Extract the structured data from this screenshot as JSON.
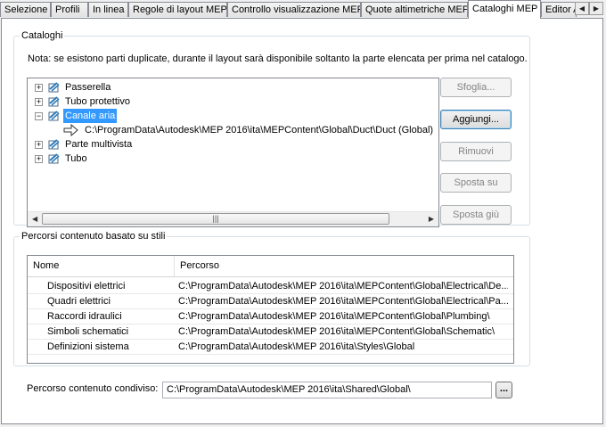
{
  "tabs": [
    {
      "label": "Selezione"
    },
    {
      "label": "Profili"
    },
    {
      "label": "In linea"
    },
    {
      "label": "Regole di layout MEP"
    },
    {
      "label": "Controllo visualizzazione MEP"
    },
    {
      "label": "Quote altimetriche MEP"
    },
    {
      "label": "Cataloghi MEP",
      "active": true
    },
    {
      "label": "Editor AEC"
    }
  ],
  "catalogs": {
    "group_title": "Cataloghi",
    "note": "Nota: se esistono parti duplicate, durante il layout sarà disponibile soltanto la parte elencata per prima nel catalogo.",
    "tree": [
      {
        "label": "Passerella",
        "expanded": false
      },
      {
        "label": "Tubo protettivo",
        "expanded": false
      },
      {
        "label": "Canale aria",
        "expanded": true,
        "selected": true,
        "children": [
          {
            "label": "C:\\ProgramData\\Autodesk\\MEP 2016\\ita\\MEPContent\\Global\\Duct\\Duct (Global)"
          }
        ]
      },
      {
        "label": "Parte multivista",
        "expanded": false
      },
      {
        "label": "Tubo",
        "expanded": false
      }
    ],
    "buttons": {
      "browse": "Sfoglia...",
      "add": "Aggiungi...",
      "remove": "Rimuovi",
      "move_up": "Sposta su",
      "move_down": "Sposta giù"
    }
  },
  "style_paths": {
    "group_title": "Percorsi contenuto basato su stili",
    "columns": [
      "Nome",
      "Percorso"
    ],
    "rows": [
      {
        "name": "Dispositivi elettrici",
        "path": "C:\\ProgramData\\Autodesk\\MEP 2016\\ita\\MEPContent\\Global\\Electrical\\De..."
      },
      {
        "name": "Quadri elettrici",
        "path": "C:\\ProgramData\\Autodesk\\MEP 2016\\ita\\MEPContent\\Global\\Electrical\\Pa..."
      },
      {
        "name": "Raccordi idraulici",
        "path": "C:\\ProgramData\\Autodesk\\MEP 2016\\ita\\MEPContent\\Global\\Plumbing\\"
      },
      {
        "name": "Simboli schematici",
        "path": "C:\\ProgramData\\Autodesk\\MEP 2016\\ita\\MEPContent\\Global\\Schematic\\"
      },
      {
        "name": "Definizioni sistema",
        "path": "C:\\ProgramData\\Autodesk\\MEP 2016\\ita\\Styles\\Global"
      }
    ]
  },
  "shared": {
    "label": "Percorso contenuto condiviso:",
    "value": "C:\\ProgramData\\Autodesk\\MEP 2016\\ita\\Shared\\Global\\",
    "browse_label": "..."
  }
}
